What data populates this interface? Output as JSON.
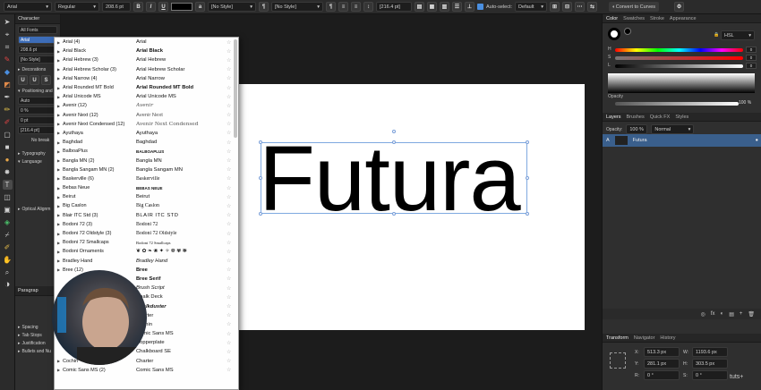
{
  "context_toolbar": {
    "font_family": "Arial",
    "font_style": "Regular",
    "font_size": "208.6 pt",
    "bold": "B",
    "italic": "I",
    "underline": "U",
    "char_style": "[No Style]",
    "para_style": "[No Style]",
    "leading": "[216.4 pt]",
    "auto_select_label": "Auto-select:",
    "auto_select_value": "Default",
    "convert_to_curves": "Convert to Curves"
  },
  "character_panel": {
    "title": "Character",
    "font_collection": "All Fonts",
    "font_field": "Arial",
    "size": "208.6 pt",
    "style": "[No Style]",
    "sections": [
      "Decorations",
      "Positioning and",
      "Typography",
      "Language",
      "Optical Alignm"
    ],
    "fields": [
      "Auto",
      "0 %",
      "0 pt",
      "[216.4 pt]"
    ],
    "no_break": "No break",
    "para_section": "Paragrap",
    "bottom_sections": [
      "Spacing",
      "Tab Stops",
      "Justification",
      "Bullets and Nu"
    ]
  },
  "font_list": [
    {
      "name": "Arial (4)",
      "preview": "Arial"
    },
    {
      "name": "Arial Black",
      "preview": "Arial Black"
    },
    {
      "name": "Arial Hebrew (3)",
      "preview": "Arial Hebrew"
    },
    {
      "name": "Arial Hebrew Scholar (3)",
      "preview": "Arial Hebrew Scholar"
    },
    {
      "name": "Arial Narrow (4)",
      "preview": "Arial Narrow"
    },
    {
      "name": "Arial Rounded MT Bold",
      "preview": "Arial Rounded MT Bold"
    },
    {
      "name": "Arial Unicode MS",
      "preview": "Arial Unicode MS"
    },
    {
      "name": "Avenir (12)",
      "preview": "Avenir"
    },
    {
      "name": "Avenir Next (12)",
      "preview": "Avenir Next"
    },
    {
      "name": "Avenir Next Condensed (12)",
      "preview": "Avenir Next Condensed"
    },
    {
      "name": "Ayuthaya",
      "preview": "Ayuthaya"
    },
    {
      "name": "Baghdad",
      "preview": "Baghdad"
    },
    {
      "name": "BalboaPlus",
      "preview": "BALBOAPLUS"
    },
    {
      "name": "Bangla MN (2)",
      "preview": "Bangla MN"
    },
    {
      "name": "Bangla Sangam MN (2)",
      "preview": "Bangla Sangam MN"
    },
    {
      "name": "Baskerville (6)",
      "preview": "Baskerville"
    },
    {
      "name": "Bebas Neue",
      "preview": "BEBAS NEUE"
    },
    {
      "name": "Beirut",
      "preview": "Beirut"
    },
    {
      "name": "Big Caslon",
      "preview": "Big Caslon"
    },
    {
      "name": "Blair ITC Std (3)",
      "preview": "BLAIR ITC STD"
    },
    {
      "name": "Bodoni 72 (3)",
      "preview": "Bodoni 72"
    },
    {
      "name": "Bodoni 72 Oldstyle (3)",
      "preview": "Bodoni 72 Oldstyle"
    },
    {
      "name": "Bodoni 72 Smallcaps",
      "preview": "Bodoni 72 Smallcaps"
    },
    {
      "name": "Bodoni Ornaments",
      "preview": "❦ ✿ ❧ ❀ ✦ ✧ ❁ ✾ ❃"
    },
    {
      "name": "Bradley Hand",
      "preview": "Bradley Hand"
    },
    {
      "name": "Bree (12)",
      "preview": "Bree"
    },
    {
      "name": "",
      "preview": "Bree Serif"
    },
    {
      "name": "",
      "preview": "Brush Script"
    },
    {
      "name": "",
      "preview": "Chalk Deck"
    },
    {
      "name": "",
      "preview": "Chalkduster"
    },
    {
      "name": "",
      "preview": "Charter"
    },
    {
      "name": "",
      "preview": "Cochin"
    },
    {
      "name": "",
      "preview": "Comic Sans MS"
    },
    {
      "name": "",
      "preview": "Copperplate"
    },
    {
      "name": "",
      "preview": "Chalkboard SE"
    },
    {
      "name": "Cochin",
      "preview": "Charter"
    },
    {
      "name": "Comic Sans MS (2)",
      "preview": "Comic Sans MS"
    }
  ],
  "canvas": {
    "text": "Futura"
  },
  "right_panel": {
    "color_tabs": [
      "Color",
      "Swatches",
      "Stroke",
      "Appearance"
    ],
    "model": "HSL",
    "h_value": "0",
    "s_value": "0",
    "l_value": "0",
    "opacity_label": "Opacity",
    "opacity_value": "100 %",
    "layer_tabs": [
      "Layers",
      "Brushes",
      "Quick FX",
      "Styles"
    ],
    "layer_opacity_label": "Opacity:",
    "layer_opacity": "100 %",
    "blend_mode": "Normal",
    "layer_name": "Futura",
    "transform_tabs": [
      "Transform",
      "Navigator",
      "History"
    ],
    "x": "513.3 px",
    "y": "281.1 px",
    "w": "1193.6 px",
    "h": "303.5 px",
    "r": "0 °",
    "s": "0 °",
    "watermark": "tuts+"
  }
}
